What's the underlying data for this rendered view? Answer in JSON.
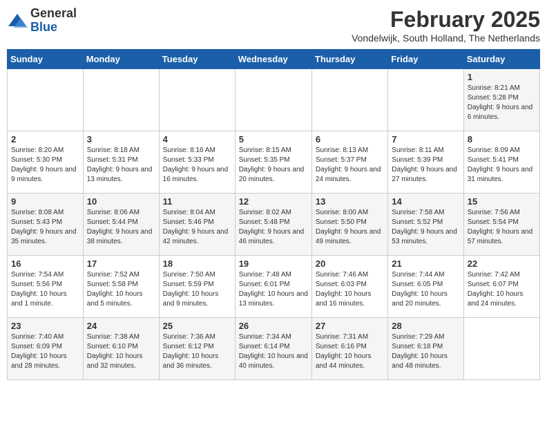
{
  "header": {
    "logo_general": "General",
    "logo_blue": "Blue",
    "month_title": "February 2025",
    "location": "Vondelwijk, South Holland, The Netherlands"
  },
  "weekdays": [
    "Sunday",
    "Monday",
    "Tuesday",
    "Wednesday",
    "Thursday",
    "Friday",
    "Saturday"
  ],
  "weeks": [
    [
      {
        "day": "",
        "info": ""
      },
      {
        "day": "",
        "info": ""
      },
      {
        "day": "",
        "info": ""
      },
      {
        "day": "",
        "info": ""
      },
      {
        "day": "",
        "info": ""
      },
      {
        "day": "",
        "info": ""
      },
      {
        "day": "1",
        "info": "Sunrise: 8:21 AM\nSunset: 5:28 PM\nDaylight: 9 hours and 6 minutes."
      }
    ],
    [
      {
        "day": "2",
        "info": "Sunrise: 8:20 AM\nSunset: 5:30 PM\nDaylight: 9 hours and 9 minutes."
      },
      {
        "day": "3",
        "info": "Sunrise: 8:18 AM\nSunset: 5:31 PM\nDaylight: 9 hours and 13 minutes."
      },
      {
        "day": "4",
        "info": "Sunrise: 8:16 AM\nSunset: 5:33 PM\nDaylight: 9 hours and 16 minutes."
      },
      {
        "day": "5",
        "info": "Sunrise: 8:15 AM\nSunset: 5:35 PM\nDaylight: 9 hours and 20 minutes."
      },
      {
        "day": "6",
        "info": "Sunrise: 8:13 AM\nSunset: 5:37 PM\nDaylight: 9 hours and 24 minutes."
      },
      {
        "day": "7",
        "info": "Sunrise: 8:11 AM\nSunset: 5:39 PM\nDaylight: 9 hours and 27 minutes."
      },
      {
        "day": "8",
        "info": "Sunrise: 8:09 AM\nSunset: 5:41 PM\nDaylight: 9 hours and 31 minutes."
      }
    ],
    [
      {
        "day": "9",
        "info": "Sunrise: 8:08 AM\nSunset: 5:43 PM\nDaylight: 9 hours and 35 minutes."
      },
      {
        "day": "10",
        "info": "Sunrise: 8:06 AM\nSunset: 5:44 PM\nDaylight: 9 hours and 38 minutes."
      },
      {
        "day": "11",
        "info": "Sunrise: 8:04 AM\nSunset: 5:46 PM\nDaylight: 9 hours and 42 minutes."
      },
      {
        "day": "12",
        "info": "Sunrise: 8:02 AM\nSunset: 5:48 PM\nDaylight: 9 hours and 46 minutes."
      },
      {
        "day": "13",
        "info": "Sunrise: 8:00 AM\nSunset: 5:50 PM\nDaylight: 9 hours and 49 minutes."
      },
      {
        "day": "14",
        "info": "Sunrise: 7:58 AM\nSunset: 5:52 PM\nDaylight: 9 hours and 53 minutes."
      },
      {
        "day": "15",
        "info": "Sunrise: 7:56 AM\nSunset: 5:54 PM\nDaylight: 9 hours and 57 minutes."
      }
    ],
    [
      {
        "day": "16",
        "info": "Sunrise: 7:54 AM\nSunset: 5:56 PM\nDaylight: 10 hours and 1 minute."
      },
      {
        "day": "17",
        "info": "Sunrise: 7:52 AM\nSunset: 5:58 PM\nDaylight: 10 hours and 5 minutes."
      },
      {
        "day": "18",
        "info": "Sunrise: 7:50 AM\nSunset: 5:59 PM\nDaylight: 10 hours and 9 minutes."
      },
      {
        "day": "19",
        "info": "Sunrise: 7:48 AM\nSunset: 6:01 PM\nDaylight: 10 hours and 13 minutes."
      },
      {
        "day": "20",
        "info": "Sunrise: 7:46 AM\nSunset: 6:03 PM\nDaylight: 10 hours and 16 minutes."
      },
      {
        "day": "21",
        "info": "Sunrise: 7:44 AM\nSunset: 6:05 PM\nDaylight: 10 hours and 20 minutes."
      },
      {
        "day": "22",
        "info": "Sunrise: 7:42 AM\nSunset: 6:07 PM\nDaylight: 10 hours and 24 minutes."
      }
    ],
    [
      {
        "day": "23",
        "info": "Sunrise: 7:40 AM\nSunset: 6:09 PM\nDaylight: 10 hours and 28 minutes."
      },
      {
        "day": "24",
        "info": "Sunrise: 7:38 AM\nSunset: 6:10 PM\nDaylight: 10 hours and 32 minutes."
      },
      {
        "day": "25",
        "info": "Sunrise: 7:36 AM\nSunset: 6:12 PM\nDaylight: 10 hours and 36 minutes."
      },
      {
        "day": "26",
        "info": "Sunrise: 7:34 AM\nSunset: 6:14 PM\nDaylight: 10 hours and 40 minutes."
      },
      {
        "day": "27",
        "info": "Sunrise: 7:31 AM\nSunset: 6:16 PM\nDaylight: 10 hours and 44 minutes."
      },
      {
        "day": "28",
        "info": "Sunrise: 7:29 AM\nSunset: 6:18 PM\nDaylight: 10 hours and 48 minutes."
      },
      {
        "day": "",
        "info": ""
      }
    ]
  ]
}
